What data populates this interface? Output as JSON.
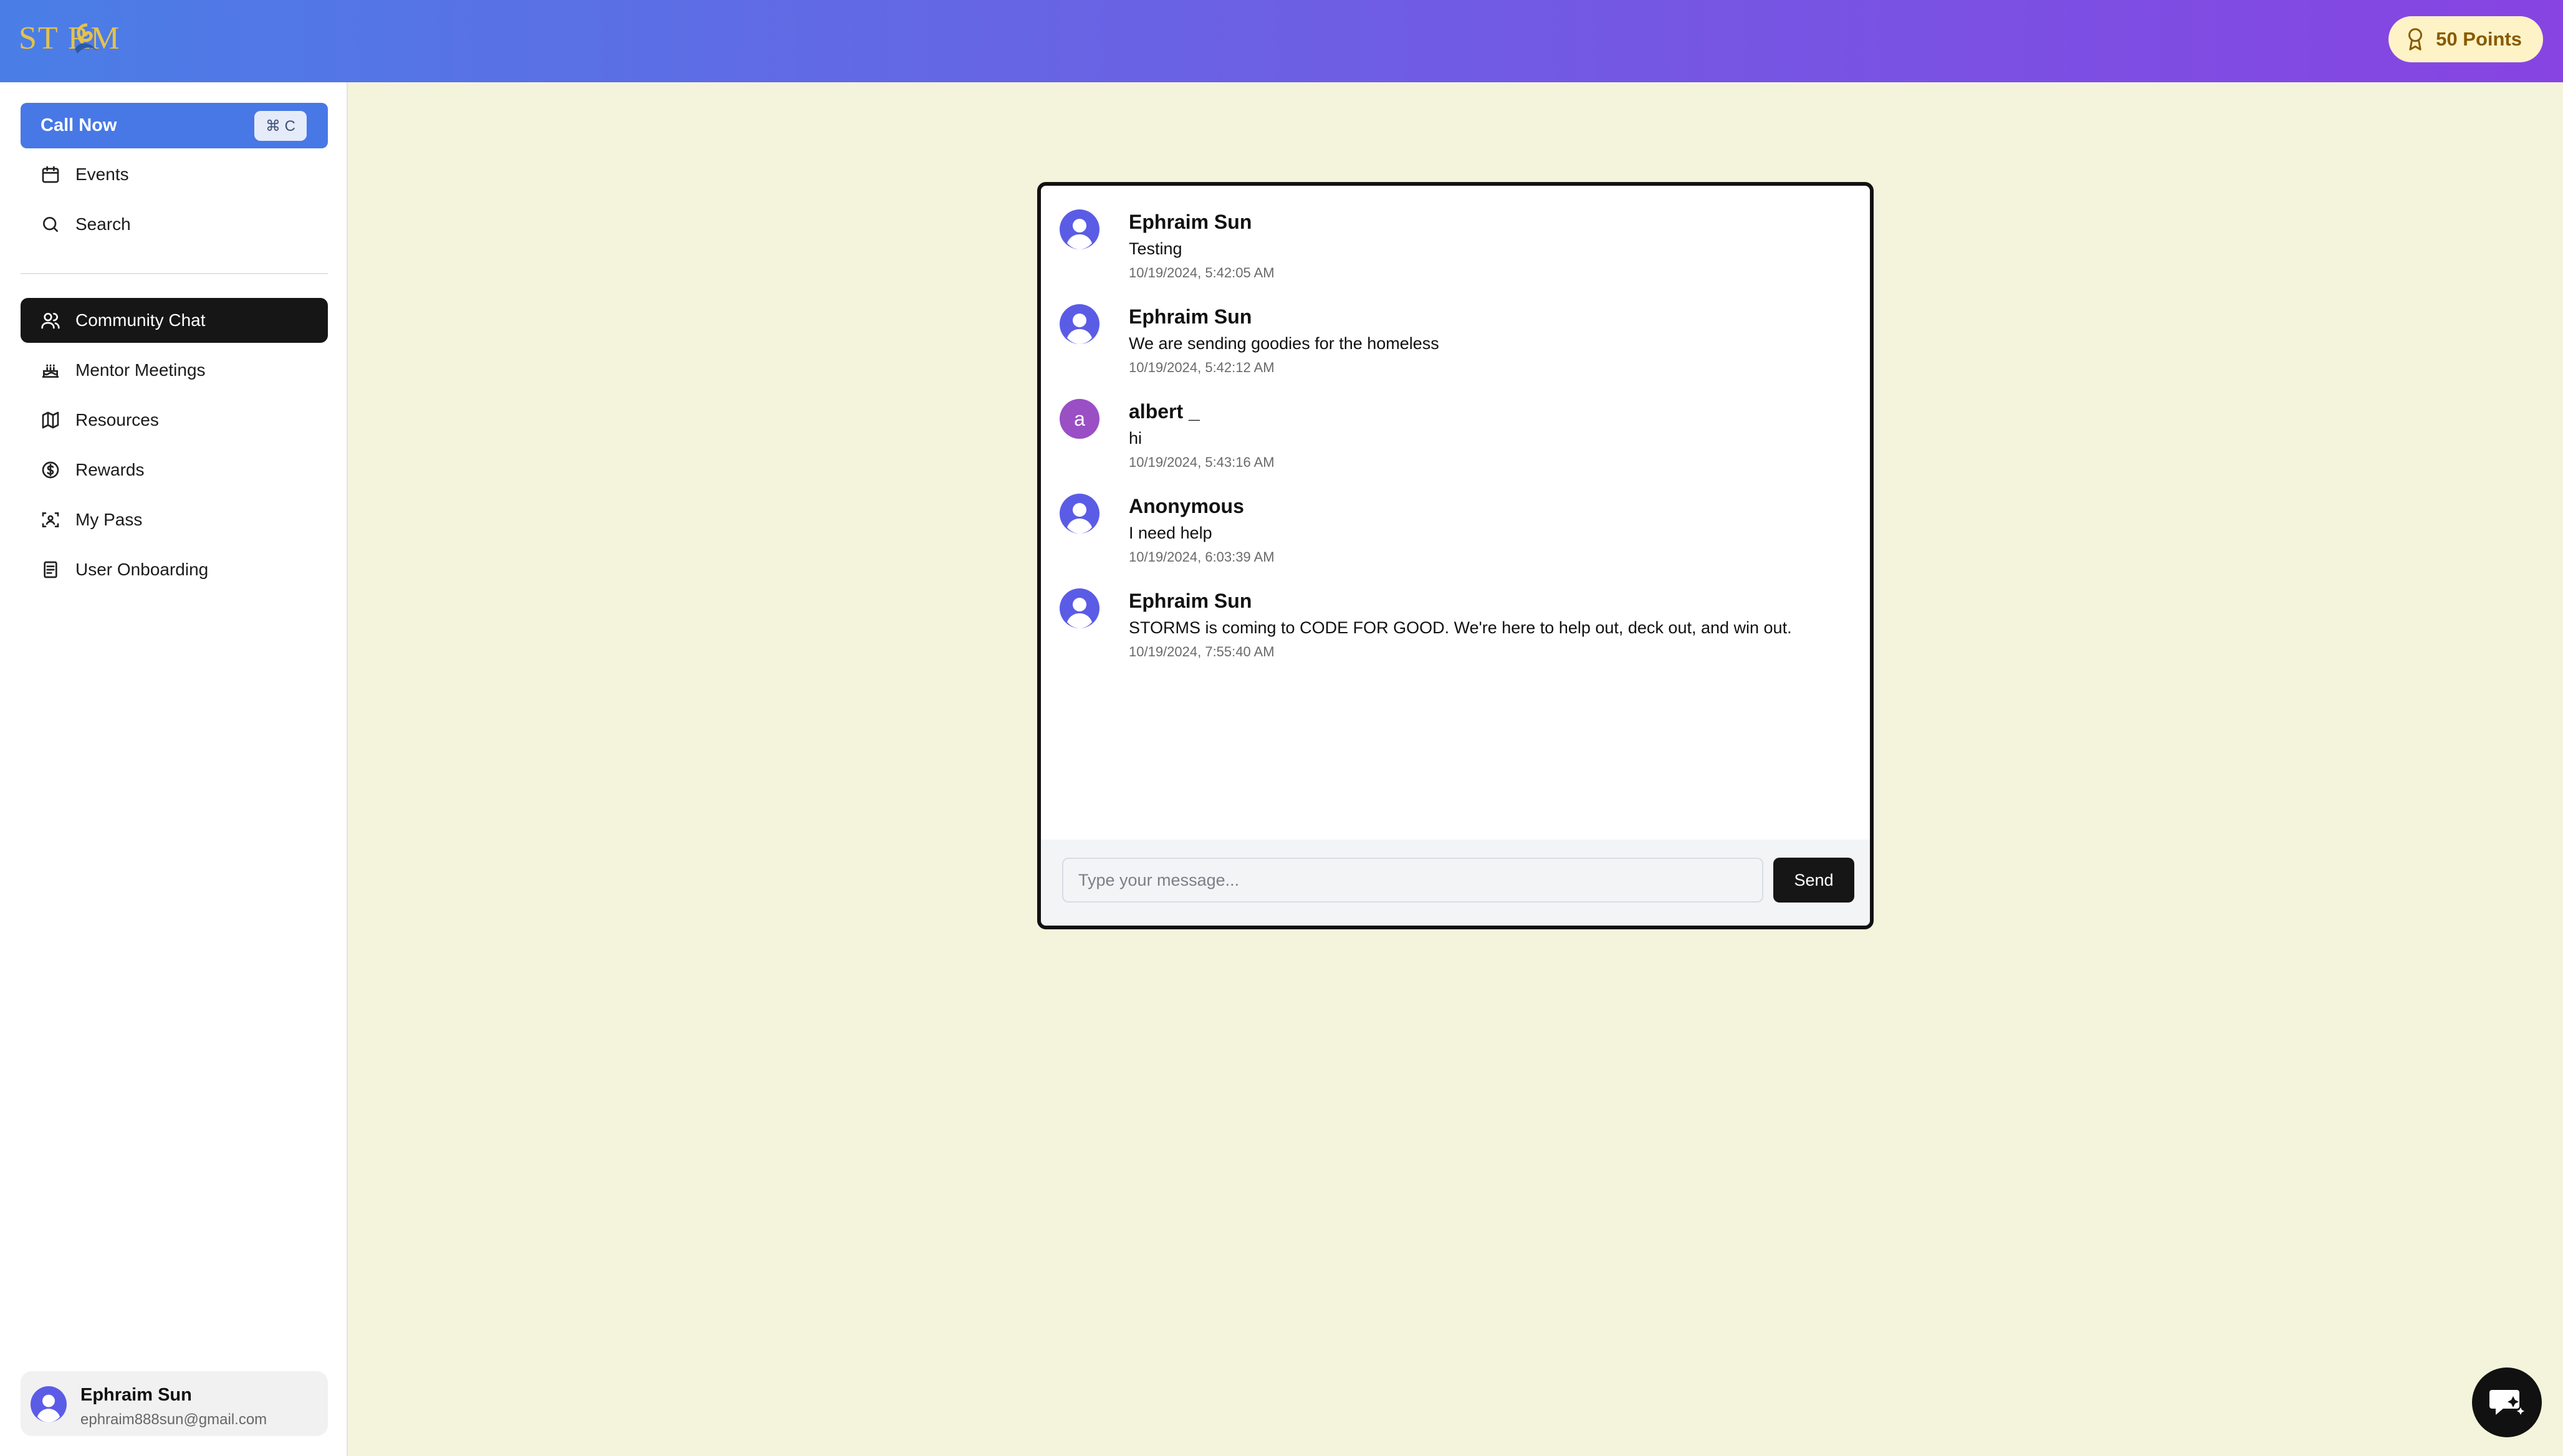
{
  "header": {
    "logo_text": "ST RM",
    "points_label": "50 Points"
  },
  "sidebar": {
    "call_button": {
      "label": "Call Now",
      "shortcut": "⌘ C"
    },
    "top_items": [
      {
        "label": "Events",
        "icon": "calendar-icon"
      },
      {
        "label": "Search",
        "icon": "search-icon"
      }
    ],
    "items": [
      {
        "label": "Community Chat",
        "icon": "users-icon",
        "active": true
      },
      {
        "label": "Mentor Meetings",
        "icon": "cake-icon"
      },
      {
        "label": "Resources",
        "icon": "map-icon"
      },
      {
        "label": "Rewards",
        "icon": "dollar-circle-icon"
      },
      {
        "label": "My Pass",
        "icon": "scan-face-icon"
      },
      {
        "label": "User Onboarding",
        "icon": "document-icon"
      }
    ],
    "profile": {
      "name": "Ephraim Sun",
      "email": "ephraim888sun@gmail.com"
    }
  },
  "chat": {
    "messages": [
      {
        "author": "Ephraim Sun",
        "text": "Testing",
        "time": "10/19/2024, 5:42:05 AM",
        "avatar": "default"
      },
      {
        "author": "Ephraim Sun",
        "text": "We are sending goodies for the homeless",
        "time": "10/19/2024, 5:42:12 AM",
        "avatar": "default"
      },
      {
        "author": "albert _",
        "text": "hi",
        "time": "10/19/2024, 5:43:16 AM",
        "avatar": "a"
      },
      {
        "author": "Anonymous",
        "text": "I need help",
        "time": "10/19/2024, 6:03:39 AM",
        "avatar": "default"
      },
      {
        "author": "Ephraim Sun",
        "text": "STORMS is coming to CODE FOR GOOD. We're here to help out, deck out, and win out.",
        "time": "10/19/2024, 7:55:40 AM",
        "avatar": "default"
      }
    ],
    "input_placeholder": "Type your message...",
    "send_label": "Send"
  },
  "colors": {
    "header_gradient_start": "#4a7ee6",
    "header_gradient_end": "#8744e2",
    "page_background": "#f4f4dc",
    "call_button": "#4778e6",
    "active_nav": "#161616",
    "avatar_default": "#5b5ce6",
    "avatar_letter": "#9a4fc4"
  }
}
